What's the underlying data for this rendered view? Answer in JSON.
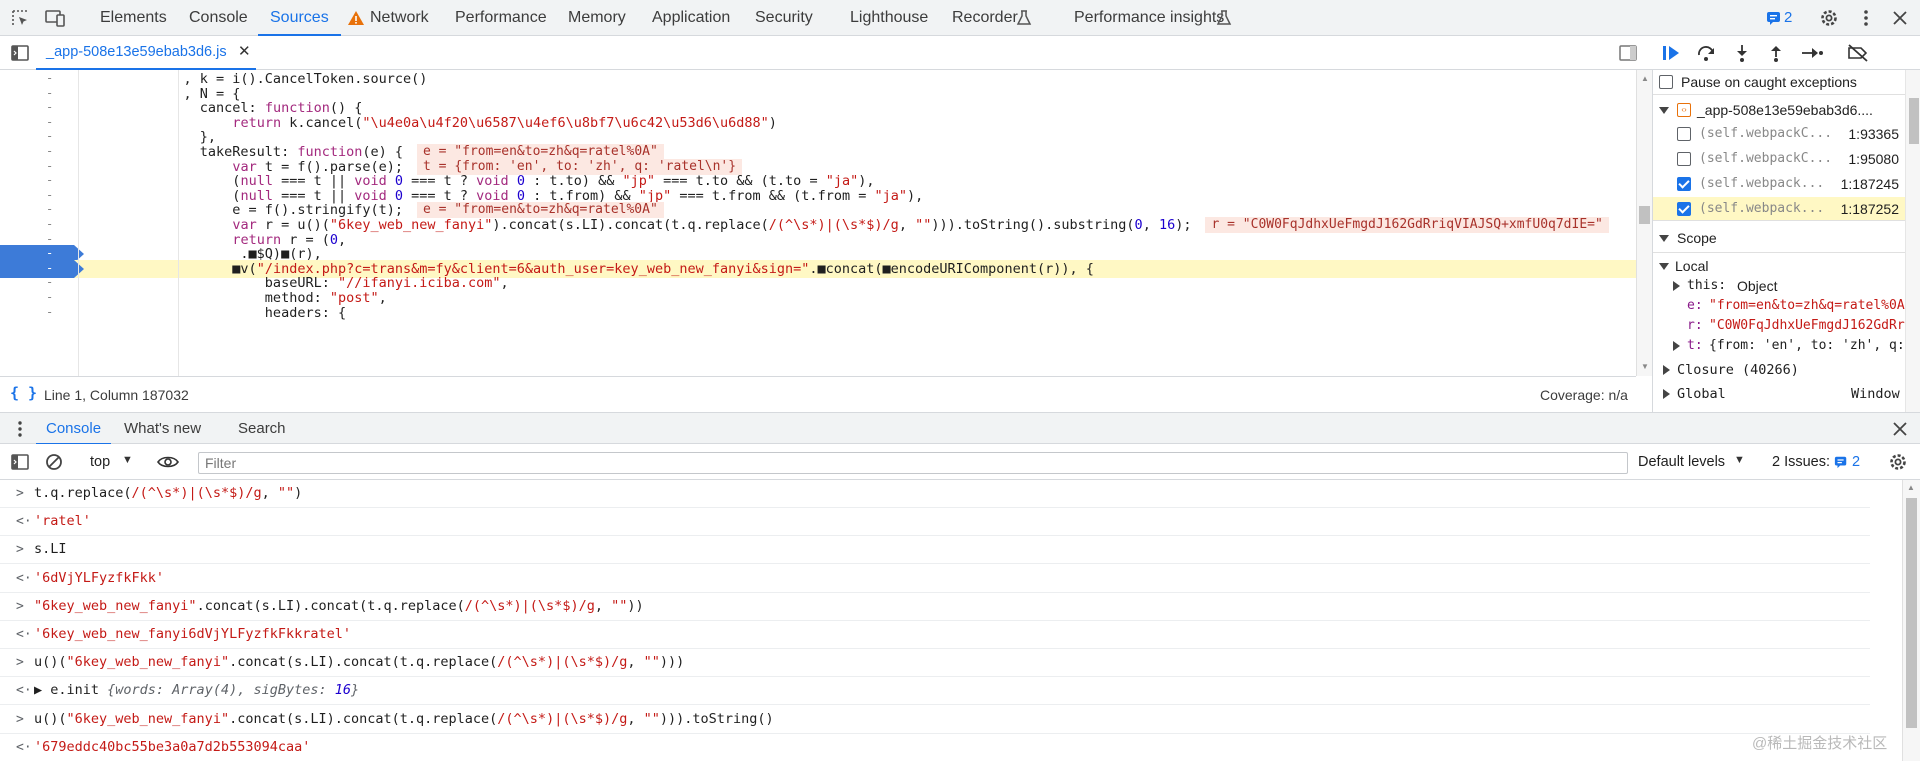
{
  "topbar": {
    "tabs": [
      "Elements",
      "Console",
      "Sources",
      "Network",
      "Performance",
      "Memory",
      "Application",
      "Security",
      "Lighthouse",
      "Recorder",
      "Performance insights"
    ],
    "active_tab": "Sources",
    "issues_count": "2"
  },
  "sources": {
    "file_tab": "_app-508e13e59ebab3d6.js"
  },
  "code": {
    "gutter_mark": "-",
    "lines": [
      {
        "t": [
          [
            "prop",
            "            , k = i().CancelToken.source()"
          ]
        ]
      },
      {
        "t": [
          [
            "prop",
            "            , N = {"
          ]
        ]
      },
      {
        "t": [
          [
            "prop",
            "              cancel: "
          ],
          [
            "kw",
            "function"
          ],
          [
            "prop",
            "() {"
          ]
        ]
      },
      {
        "t": [
          [
            "prop",
            "                  "
          ],
          [
            "kw",
            "return"
          ],
          [
            "prop",
            " k.cancel("
          ],
          [
            "str",
            "\"\\u4e0a\\u4f20\\u6587\\u4ef6\\u8bf7\\u6c42\\u53d6\\u6d88\""
          ],
          [
            "prop",
            ")"
          ]
        ]
      },
      {
        "t": [
          [
            "prop",
            "              },"
          ]
        ]
      },
      {
        "t": [
          [
            "prop",
            "              takeResult: "
          ],
          [
            "kw",
            "function"
          ],
          [
            "prop",
            "(e) {"
          ]
        ]
      },
      {
        "t": [
          [
            "prop",
            "                  "
          ],
          [
            "kw",
            "var"
          ],
          [
            "prop",
            " t = f().parse(e);"
          ]
        ]
      },
      {
        "t": [
          [
            "prop",
            "                  ("
          ],
          [
            "kw",
            "null"
          ],
          [
            "prop",
            " === t || "
          ],
          [
            "kw",
            "void"
          ],
          [
            "num",
            " 0"
          ],
          [
            "prop",
            " === t ? "
          ],
          [
            "kw",
            "void"
          ],
          [
            "num",
            " 0"
          ],
          [
            "prop",
            " : t.to) && "
          ],
          [
            "str",
            "\"jp\""
          ],
          [
            "prop",
            " === t.to && (t.to = "
          ],
          [
            "str",
            "\"ja\""
          ],
          [
            "prop",
            "),"
          ]
        ]
      },
      {
        "t": [
          [
            "prop",
            "                  ("
          ],
          [
            "kw",
            "null"
          ],
          [
            "prop",
            " === t || "
          ],
          [
            "kw",
            "void"
          ],
          [
            "num",
            " 0"
          ],
          [
            "prop",
            " === t ? "
          ],
          [
            "kw",
            "void"
          ],
          [
            "num",
            " 0"
          ],
          [
            "prop",
            " : t.from) && "
          ],
          [
            "str",
            "\"jp\""
          ],
          [
            "prop",
            " === t.from && (t.from = "
          ],
          [
            "str",
            "\"ja\""
          ],
          [
            "prop",
            "),"
          ]
        ]
      },
      {
        "t": [
          [
            "prop",
            "                  e = f().stringify(t);"
          ]
        ]
      },
      {
        "t": [
          [
            "prop",
            "                  "
          ],
          [
            "kw",
            "var"
          ],
          [
            "prop",
            " r = u()("
          ],
          [
            "str",
            "\"6key_web_new_fanyi\""
          ],
          [
            "prop",
            ").concat(s.LI).concat(t.q.replace("
          ],
          [
            "str",
            "/(^\\s*)|(\\s*$)/g"
          ],
          [
            "prop",
            ", "
          ],
          [
            "str",
            "\"\""
          ],
          [
            "prop",
            "))).toString().substring("
          ],
          [
            "num",
            "0"
          ],
          [
            "prop",
            ", "
          ],
          [
            "num",
            "16"
          ],
          [
            "prop",
            ");"
          ]
        ]
      },
      {
        "t": [
          [
            "prop",
            "                  "
          ],
          [
            "kw",
            "return"
          ],
          [
            "prop",
            " r = ("
          ],
          [
            "num",
            "0"
          ],
          [
            "prop",
            ","
          ]
        ]
      },
      {
        "t": [
          [
            "prop",
            "                  _.■$Q)■(r),"
          ]
        ]
      },
      {
        "t": [
          [
            "prop",
            "                  ■v("
          ],
          [
            "str",
            "\"/index.php?c=trans&m=fy&client=6&auth_user=key_web_new_fanyi&sign=\""
          ],
          [
            "prop",
            ".■concat(■encodeURIComponent(r)), {"
          ]
        ]
      },
      {
        "t": [
          [
            "prop",
            "                      baseURL: "
          ],
          [
            "str",
            "\"//ifanyi.iciba.com\""
          ],
          [
            "prop",
            ","
          ]
        ]
      },
      {
        "t": [
          [
            "prop",
            "                      method: "
          ],
          [
            "str",
            "\"post\""
          ],
          [
            "prop",
            ","
          ]
        ]
      },
      {
        "t": [
          [
            "prop",
            "                      headers: {"
          ]
        ]
      }
    ],
    "inline_values": [
      {
        "line": 5,
        "text": "e = \"from=en&to=zh&q=ratel%0A\""
      },
      {
        "line": 6,
        "text": "t = {from: 'en', to: 'zh', q: 'ratel\\n'}"
      },
      {
        "line": 9,
        "text": "e = \"from=en&to=zh&q=ratel%0A\""
      },
      {
        "line": 10,
        "text": "r = \"C0W0FqJdhxUeFmgdJ162GdRriqVIAJSQ+xmfU0q7dIE=\""
      }
    ]
  },
  "status": {
    "position": "Line 1, Column 187032",
    "coverage": "Coverage: n/a"
  },
  "debugger": {
    "pause_caught": "Pause on caught exceptions",
    "breakpoint_file": "_app-508e13e59ebab3d6....",
    "breakpoints": [
      {
        "label": "(self.webpackC...",
        "loc": "1:93365",
        "checked": false
      },
      {
        "label": "(self.webpackC...",
        "loc": "1:95080",
        "checked": false
      },
      {
        "label": "(self.webpack...",
        "loc": "1:187245",
        "checked": true
      },
      {
        "label": "(self.webpack...",
        "loc": "1:187252",
        "checked": true
      }
    ],
    "scope_title": "Scope",
    "local_title": "Local",
    "local_vars": [
      {
        "name": "this:",
        "value": "Object"
      },
      {
        "name": "e:",
        "value": "\"from=en&to=zh&q=ratel%0A\""
      },
      {
        "name": "r:",
        "value": "\"C0W0FqJdhxUeFmgdJ162GdRriqVIAJSQ+xmfU0q7dIE=\""
      },
      {
        "name": "t:",
        "value": "{from: 'en', to: 'zh', q: 'ratel\\n'}"
      }
    ],
    "closure": "Closure (40266)",
    "global": "Global",
    "global_value": "Window"
  },
  "drawer": {
    "tabs": [
      "Console",
      "What's new",
      "Search"
    ],
    "active_tab": "Console",
    "context": "top",
    "filter_placeholder": "Filter",
    "levels": "Default levels",
    "issues_label": "2 Issues:",
    "issues_count": "2"
  },
  "console": {
    "rows": [
      {
        "kind": "in",
        "t": [
          [
            "p",
            "t.q.replace("
          ],
          [
            "s",
            "/(^\\s*)|(\\s*$)/g"
          ],
          [
            "p",
            ", "
          ],
          [
            "s",
            "\"\""
          ],
          [
            "p",
            ")"
          ]
        ]
      },
      {
        "kind": "out",
        "t": [
          [
            "s",
            "'ratel'"
          ]
        ]
      },
      {
        "kind": "in",
        "t": [
          [
            "p",
            "s.LI"
          ]
        ]
      },
      {
        "kind": "out",
        "t": [
          [
            "s",
            "'6dVjYLFyzfkFkk'"
          ]
        ]
      },
      {
        "kind": "in",
        "t": [
          [
            "s",
            "\"6key_web_new_fanyi\""
          ],
          [
            "p",
            ".concat(s.LI).concat(t.q.replace("
          ],
          [
            "s",
            "/(^\\s*)|(\\s*$)/g"
          ],
          [
            "p",
            ", "
          ],
          [
            "s",
            "\"\""
          ],
          [
            "p",
            "))"
          ]
        ]
      },
      {
        "kind": "out",
        "t": [
          [
            "s",
            "'6key_web_new_fanyi6dVjYLFyzfkFkkratel'"
          ]
        ]
      },
      {
        "kind": "in",
        "t": [
          [
            "p",
            "u()("
          ],
          [
            "s",
            "\"6key_web_new_fanyi\""
          ],
          [
            "p",
            ".concat(s.LI).concat(t.q.replace("
          ],
          [
            "s",
            "/(^\\s*)|(\\s*$)/g"
          ],
          [
            "p",
            ", "
          ],
          [
            "s",
            "\"\""
          ],
          [
            "p",
            ")))"
          ]
        ]
      },
      {
        "kind": "out",
        "t": [
          [
            "p",
            "▶ e.init "
          ],
          [
            "i",
            "{words: Array(4), sigBytes: "
          ],
          [
            "n",
            "16"
          ],
          [
            "i",
            "}"
          ]
        ]
      },
      {
        "kind": "in",
        "t": [
          [
            "p",
            "u()("
          ],
          [
            "s",
            "\"6key_web_new_fanyi\""
          ],
          [
            "p",
            ".concat(s.LI).concat(t.q.replace("
          ],
          [
            "s",
            "/(^\\s*)|(\\s*$)/g"
          ],
          [
            "p",
            ", "
          ],
          [
            "s",
            "\"\""
          ],
          [
            "p",
            "))).toString()"
          ]
        ]
      },
      {
        "kind": "out",
        "t": [
          [
            "s",
            "'679eddc40bc55be3a0a7d2b553094caa'"
          ]
        ]
      }
    ]
  },
  "watermark": "@稀土掘金技术社区"
}
